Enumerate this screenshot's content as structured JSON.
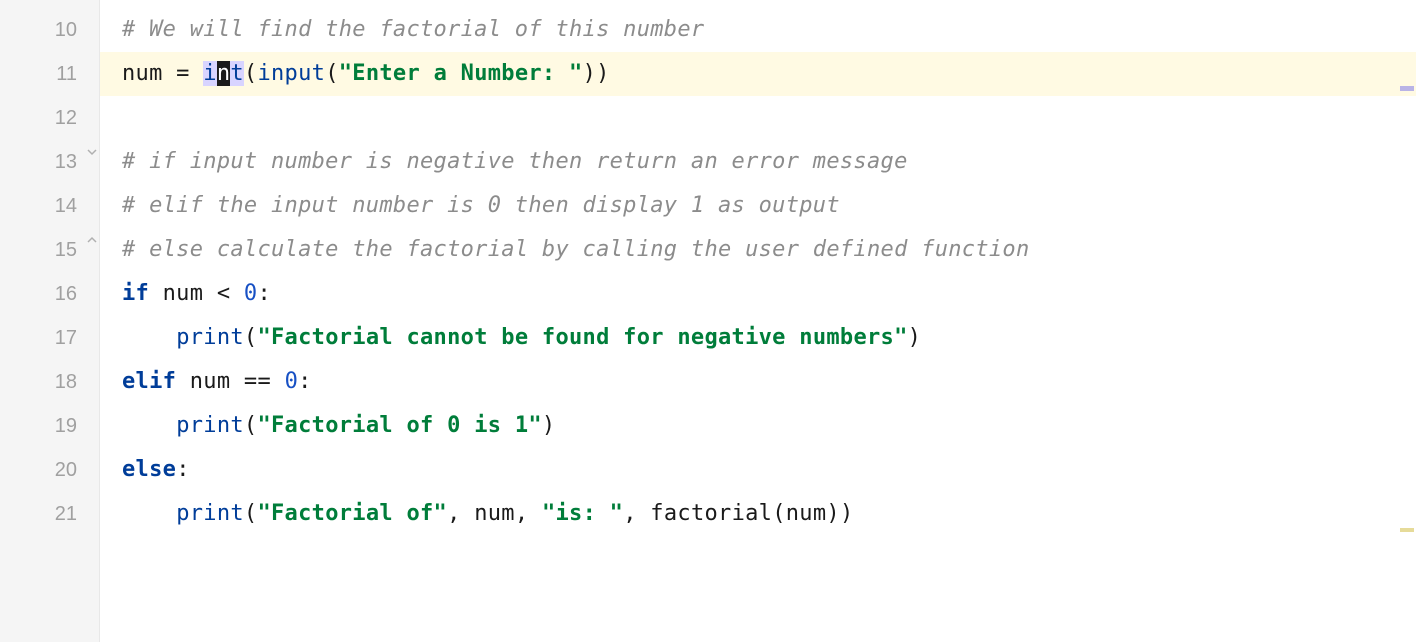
{
  "gutter": {
    "lines": [
      "10",
      "11",
      "12",
      "13",
      "14",
      "15",
      "16",
      "17",
      "18",
      "19",
      "20",
      "21"
    ]
  },
  "code": {
    "l10": "# We will find the factorial of this number",
    "l11_a": "num = ",
    "l11_b": "i",
    "l11_c": "n",
    "l11_d": "t",
    "l11_e": "(",
    "l11_f": "input",
    "l11_g": "(",
    "l11_h": "\"Enter a Number: \"",
    "l11_i": "))",
    "l13": "# if input number is negative then return an error message",
    "l14": "# elif the input number is 0 then display 1 as output",
    "l15": "# else calculate the factorial by calling the user defined function",
    "l16_a": "if ",
    "l16_b": "num < ",
    "l16_c": "0",
    "l16_d": ":",
    "l17_a": "    ",
    "l17_b": "print",
    "l17_c": "(",
    "l17_d": "\"Factorial cannot be found for negative numbers\"",
    "l17_e": ")",
    "l18_a": "elif ",
    "l18_b": "num == ",
    "l18_c": "0",
    "l18_d": ":",
    "l19_a": "    ",
    "l19_b": "print",
    "l19_c": "(",
    "l19_d": "\"Factorial of 0 is 1\"",
    "l19_e": ")",
    "l20_a": "else",
    "l20_b": ":",
    "l21_a": "    ",
    "l21_b": "print",
    "l21_c": "(",
    "l21_d": "\"Factorial of\"",
    "l21_e": ", num, ",
    "l21_f": "\"is: \"",
    "l21_g": ", factorial(num))"
  }
}
